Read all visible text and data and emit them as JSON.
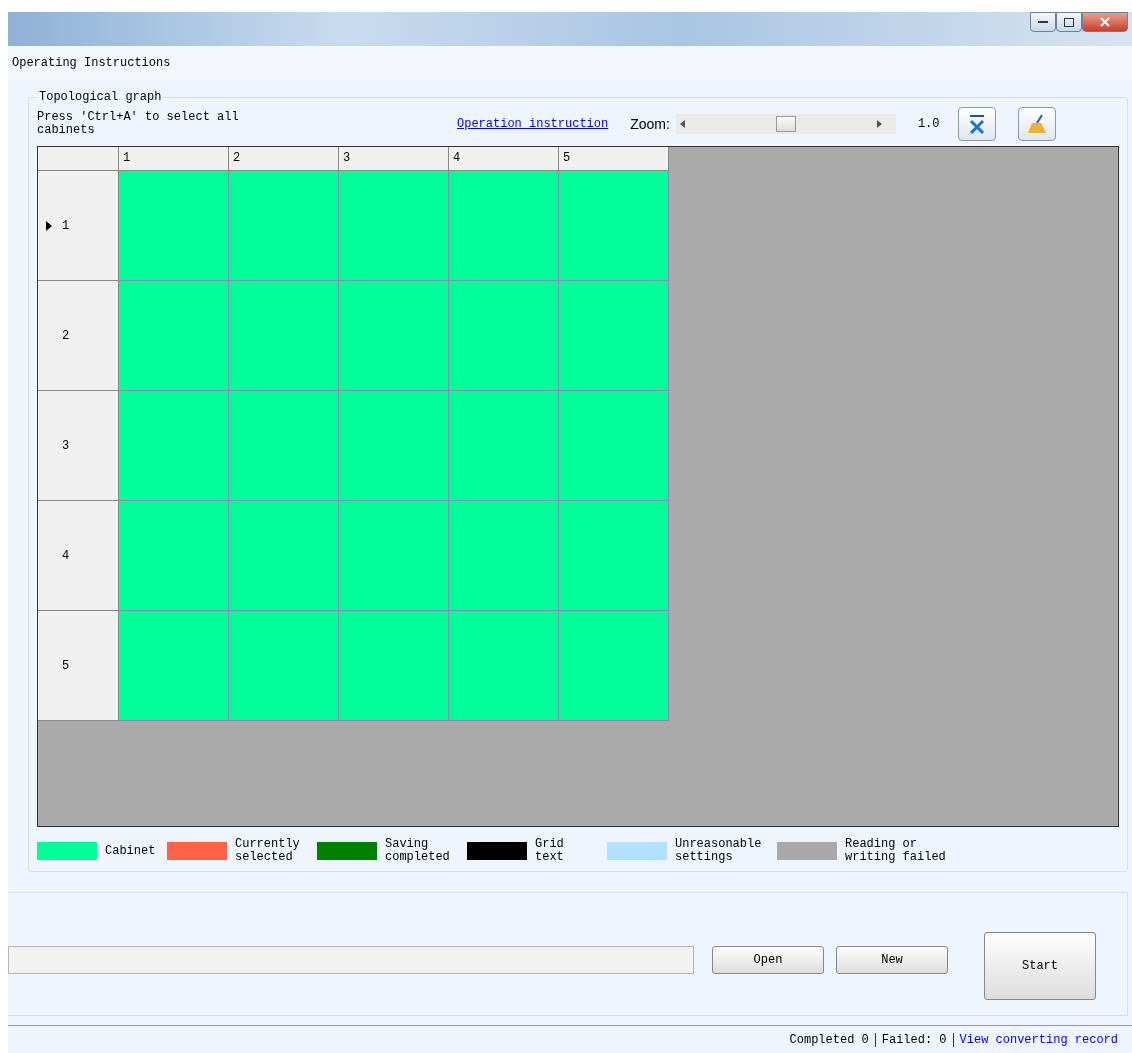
{
  "menu": {
    "title": "Operating Instructions"
  },
  "topology": {
    "title": "Topological graph",
    "hint": "Press 'Ctrl+A' to select all cabinets",
    "link": "Operation instruction",
    "zoom_label": "Zoom:",
    "zoom": {
      "level": 0.5
    },
    "zoom_value": "1.0",
    "columns": [
      "1",
      "2",
      "3",
      "4",
      "5"
    ],
    "rows": [
      {
        "label": "1",
        "current": true,
        "cells": [
          {
            "kind": "cabinet"
          },
          {
            "kind": "cabinet"
          },
          {
            "kind": "cabinet"
          },
          {
            "kind": "cabinet"
          },
          {
            "kind": "cabinet"
          }
        ]
      },
      {
        "label": "2",
        "current": false,
        "cells": [
          {
            "kind": "cabinet"
          },
          {
            "kind": "cabinet"
          },
          {
            "kind": "cabinet"
          },
          {
            "kind": "cabinet"
          },
          {
            "kind": "cabinet"
          }
        ]
      },
      {
        "label": "3",
        "current": false,
        "cells": [
          {
            "kind": "cabinet"
          },
          {
            "kind": "cabinet"
          },
          {
            "kind": "cabinet"
          },
          {
            "kind": "cabinet"
          },
          {
            "kind": "cabinet"
          }
        ]
      },
      {
        "label": "4",
        "current": false,
        "cells": [
          {
            "kind": "cabinet"
          },
          {
            "kind": "cabinet"
          },
          {
            "kind": "cabinet"
          },
          {
            "kind": "cabinet"
          },
          {
            "kind": "cabinet"
          }
        ]
      },
      {
        "label": "5",
        "current": false,
        "cells": [
          {
            "kind": "cabinet"
          },
          {
            "kind": "cabinet"
          },
          {
            "kind": "cabinet"
          },
          {
            "kind": "cabinet"
          },
          {
            "kind": "cabinet"
          }
        ]
      }
    ],
    "legend": [
      {
        "label": "Cabinet",
        "color": "#00ff99"
      },
      {
        "label": "Currently selected",
        "color": "#ff6347"
      },
      {
        "label": "Saving completed",
        "color": "#008000"
      },
      {
        "label": "Grid text",
        "color": "#000000"
      },
      {
        "label": "Unreasonable settings",
        "color": "#b0e2ff"
      },
      {
        "label": "Reading or writing failed",
        "color": "#a9a9a9"
      }
    ]
  },
  "actions": {
    "buttons": [
      "Open",
      "New"
    ],
    "start": "Start"
  },
  "status_bar": {
    "completed": "Completed 0",
    "failed": "Failed: 0",
    "link": "View converting record"
  }
}
